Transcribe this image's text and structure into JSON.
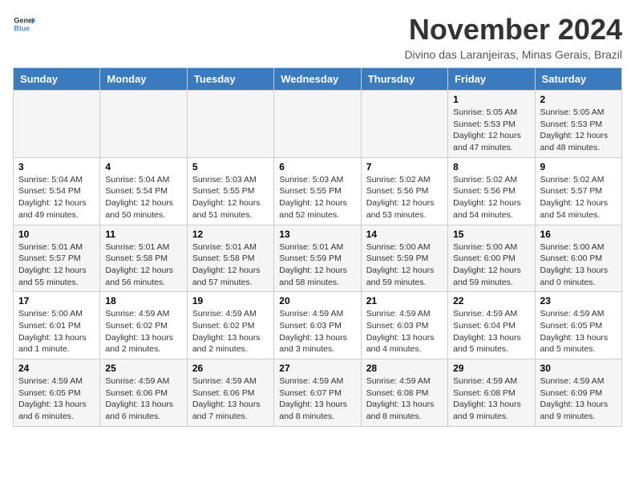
{
  "logo": {
    "line1": "General",
    "line2": "Blue"
  },
  "title": "November 2024",
  "subtitle": "Divino das Laranjeiras, Minas Gerais, Brazil",
  "weekdays": [
    "Sunday",
    "Monday",
    "Tuesday",
    "Wednesday",
    "Thursday",
    "Friday",
    "Saturday"
  ],
  "weeks": [
    [
      {
        "day": "",
        "info": ""
      },
      {
        "day": "",
        "info": ""
      },
      {
        "day": "",
        "info": ""
      },
      {
        "day": "",
        "info": ""
      },
      {
        "day": "",
        "info": ""
      },
      {
        "day": "1",
        "info": "Sunrise: 5:05 AM\nSunset: 5:53 PM\nDaylight: 12 hours\nand 47 minutes."
      },
      {
        "day": "2",
        "info": "Sunrise: 5:05 AM\nSunset: 5:53 PM\nDaylight: 12 hours\nand 48 minutes."
      }
    ],
    [
      {
        "day": "3",
        "info": "Sunrise: 5:04 AM\nSunset: 5:54 PM\nDaylight: 12 hours\nand 49 minutes."
      },
      {
        "day": "4",
        "info": "Sunrise: 5:04 AM\nSunset: 5:54 PM\nDaylight: 12 hours\nand 50 minutes."
      },
      {
        "day": "5",
        "info": "Sunrise: 5:03 AM\nSunset: 5:55 PM\nDaylight: 12 hours\nand 51 minutes."
      },
      {
        "day": "6",
        "info": "Sunrise: 5:03 AM\nSunset: 5:55 PM\nDaylight: 12 hours\nand 52 minutes."
      },
      {
        "day": "7",
        "info": "Sunrise: 5:02 AM\nSunset: 5:56 PM\nDaylight: 12 hours\nand 53 minutes."
      },
      {
        "day": "8",
        "info": "Sunrise: 5:02 AM\nSunset: 5:56 PM\nDaylight: 12 hours\nand 54 minutes."
      },
      {
        "day": "9",
        "info": "Sunrise: 5:02 AM\nSunset: 5:57 PM\nDaylight: 12 hours\nand 54 minutes."
      }
    ],
    [
      {
        "day": "10",
        "info": "Sunrise: 5:01 AM\nSunset: 5:57 PM\nDaylight: 12 hours\nand 55 minutes."
      },
      {
        "day": "11",
        "info": "Sunrise: 5:01 AM\nSunset: 5:58 PM\nDaylight: 12 hours\nand 56 minutes."
      },
      {
        "day": "12",
        "info": "Sunrise: 5:01 AM\nSunset: 5:58 PM\nDaylight: 12 hours\nand 57 minutes."
      },
      {
        "day": "13",
        "info": "Sunrise: 5:01 AM\nSunset: 5:59 PM\nDaylight: 12 hours\nand 58 minutes."
      },
      {
        "day": "14",
        "info": "Sunrise: 5:00 AM\nSunset: 5:59 PM\nDaylight: 12 hours\nand 59 minutes."
      },
      {
        "day": "15",
        "info": "Sunrise: 5:00 AM\nSunset: 6:00 PM\nDaylight: 12 hours\nand 59 minutes."
      },
      {
        "day": "16",
        "info": "Sunrise: 5:00 AM\nSunset: 6:00 PM\nDaylight: 13 hours\nand 0 minutes."
      }
    ],
    [
      {
        "day": "17",
        "info": "Sunrise: 5:00 AM\nSunset: 6:01 PM\nDaylight: 13 hours\nand 1 minute."
      },
      {
        "day": "18",
        "info": "Sunrise: 4:59 AM\nSunset: 6:02 PM\nDaylight: 13 hours\nand 2 minutes."
      },
      {
        "day": "19",
        "info": "Sunrise: 4:59 AM\nSunset: 6:02 PM\nDaylight: 13 hours\nand 2 minutes."
      },
      {
        "day": "20",
        "info": "Sunrise: 4:59 AM\nSunset: 6:03 PM\nDaylight: 13 hours\nand 3 minutes."
      },
      {
        "day": "21",
        "info": "Sunrise: 4:59 AM\nSunset: 6:03 PM\nDaylight: 13 hours\nand 4 minutes."
      },
      {
        "day": "22",
        "info": "Sunrise: 4:59 AM\nSunset: 6:04 PM\nDaylight: 13 hours\nand 5 minutes."
      },
      {
        "day": "23",
        "info": "Sunrise: 4:59 AM\nSunset: 6:05 PM\nDaylight: 13 hours\nand 5 minutes."
      }
    ],
    [
      {
        "day": "24",
        "info": "Sunrise: 4:59 AM\nSunset: 6:05 PM\nDaylight: 13 hours\nand 6 minutes."
      },
      {
        "day": "25",
        "info": "Sunrise: 4:59 AM\nSunset: 6:06 PM\nDaylight: 13 hours\nand 6 minutes."
      },
      {
        "day": "26",
        "info": "Sunrise: 4:59 AM\nSunset: 6:06 PM\nDaylight: 13 hours\nand 7 minutes."
      },
      {
        "day": "27",
        "info": "Sunrise: 4:59 AM\nSunset: 6:07 PM\nDaylight: 13 hours\nand 8 minutes."
      },
      {
        "day": "28",
        "info": "Sunrise: 4:59 AM\nSunset: 6:08 PM\nDaylight: 13 hours\nand 8 minutes."
      },
      {
        "day": "29",
        "info": "Sunrise: 4:59 AM\nSunset: 6:08 PM\nDaylight: 13 hours\nand 9 minutes."
      },
      {
        "day": "30",
        "info": "Sunrise: 4:59 AM\nSunset: 6:09 PM\nDaylight: 13 hours\nand 9 minutes."
      }
    ]
  ]
}
